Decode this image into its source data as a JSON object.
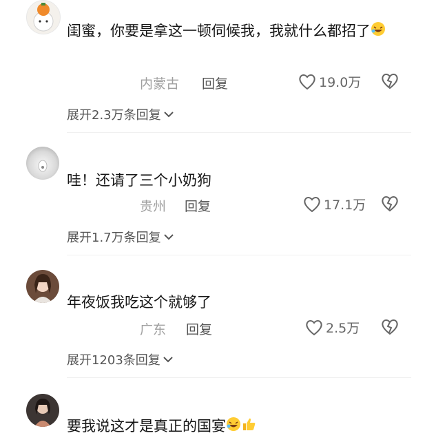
{
  "comments": [
    {
      "text": "闺蜜，你要是拿这一顿伺候我，我就什么都招了",
      "emoji": "rofl",
      "location": "内蒙古",
      "reply_label": "回复",
      "likes": "19.0万",
      "expand_label": "展开2.3万条回复"
    },
    {
      "text": "哇！还请了三个小奶狗",
      "location": "贵州",
      "reply_label": "回复",
      "likes": "17.1万",
      "expand_label": "展开1.7万条回复"
    },
    {
      "text": "年夜饭我吃这个就够了",
      "location": "广东",
      "reply_label": "回复",
      "likes": "2.5万",
      "expand_label": "展开1203条回复"
    },
    {
      "text": "要我说这才是真正的国宴",
      "emoji": "rofl + thumbs-up"
    }
  ],
  "colors": {
    "text": "#161616",
    "meta": "#a0a0a0",
    "icon": "#666666"
  }
}
